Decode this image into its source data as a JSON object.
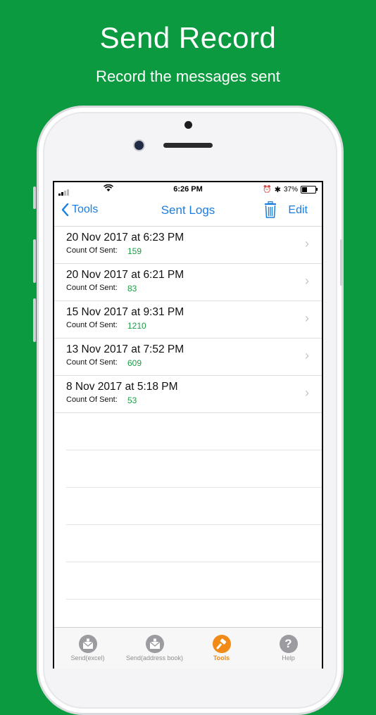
{
  "promo": {
    "title": "Send Record",
    "subtitle": "Record the messages sent"
  },
  "status_bar": {
    "time": "6:26 PM",
    "battery_text": "37%",
    "battery_level": 0.37
  },
  "nav": {
    "back_label": "Tools",
    "title": "Sent Logs",
    "edit_label": "Edit"
  },
  "records": [
    {
      "date": "20 Nov 2017 at 6:23 PM",
      "count_label": "Count Of Sent:",
      "count": "159"
    },
    {
      "date": "20 Nov 2017 at 6:21 PM",
      "count_label": "Count Of Sent:",
      "count": "83"
    },
    {
      "date": "15  Nov 2017 at 9:31  PM",
      "count_label": "Count Of Sent:",
      "count": "1210"
    },
    {
      "date": "13  Nov 2017 at 7:52  PM",
      "count_label": "Count Of Sent:",
      "count": "609"
    },
    {
      "date": "8   Nov 2017 at 5:18 PM",
      "count_label": "Count Of Sent:",
      "count": "53"
    }
  ],
  "tabs": [
    {
      "label": "Send(excel)",
      "icon": "envelope-icon"
    },
    {
      "label": "Send(address book)",
      "icon": "envelope-icon"
    },
    {
      "label": "Tools",
      "icon": "hammer-icon"
    },
    {
      "label": "Help",
      "icon": "question-icon"
    }
  ],
  "colors": {
    "background": "#0b9a3f",
    "accent": "#1a7ee0",
    "count": "#1e9a45",
    "active_tab": "#f28a18"
  }
}
